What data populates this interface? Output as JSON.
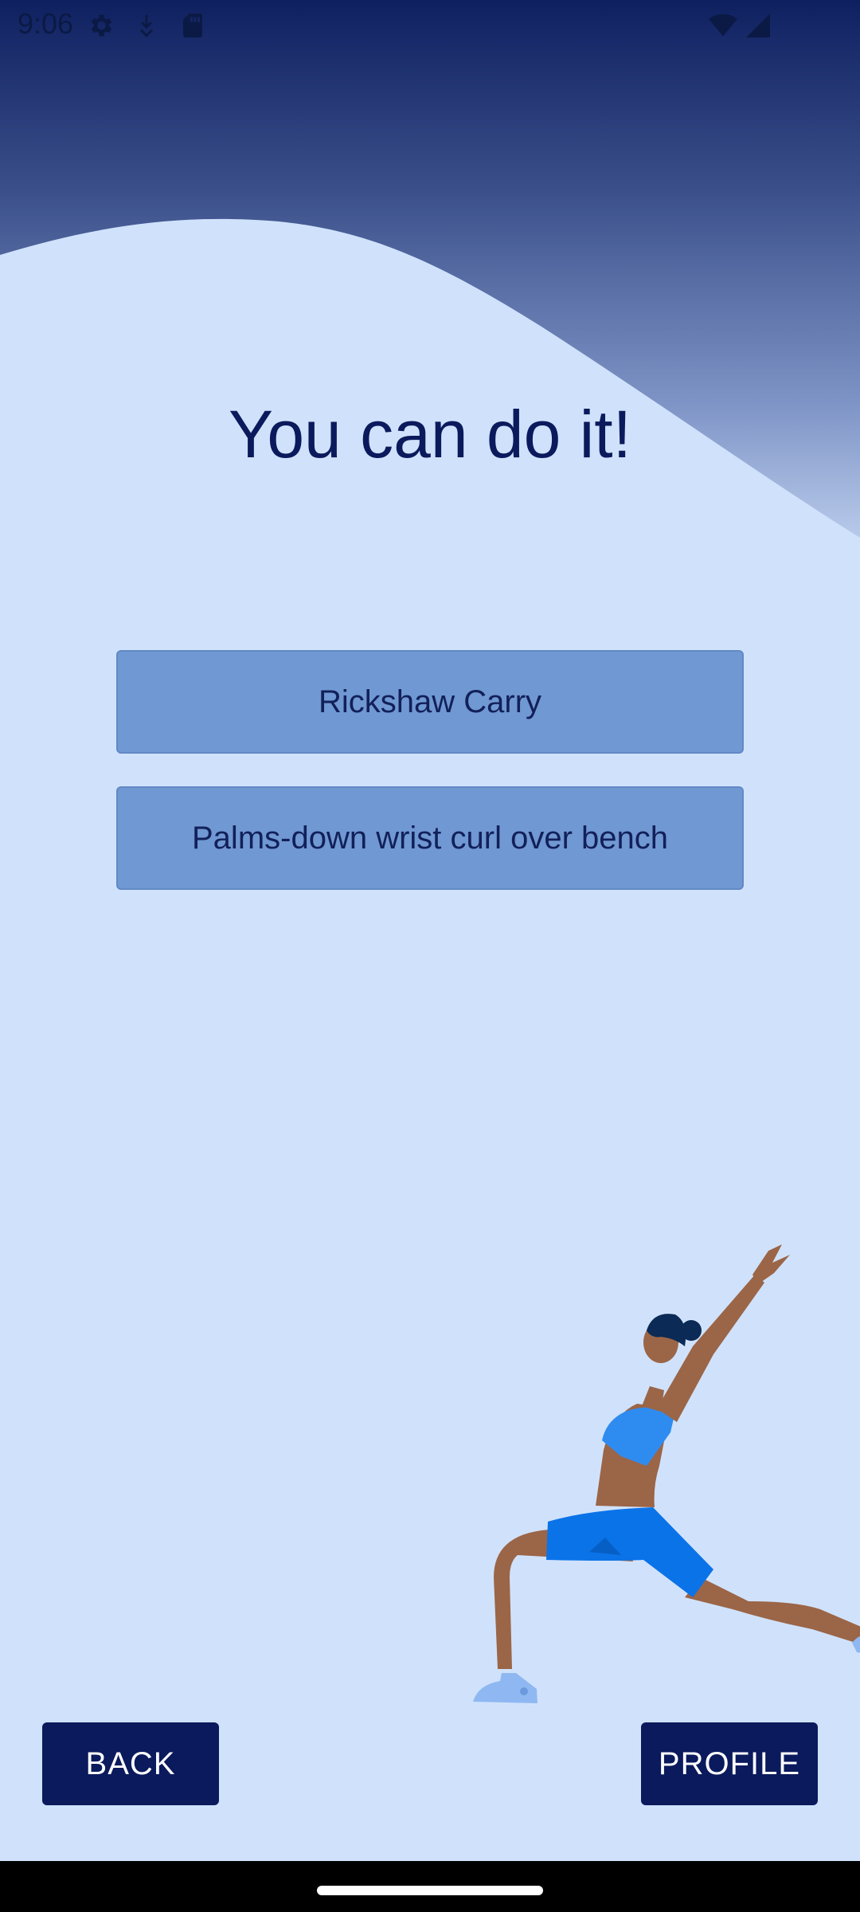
{
  "status_bar": {
    "time": "9:06",
    "icons": [
      "gear-icon",
      "download-icon",
      "sd-card-icon",
      "wifi-icon",
      "signal-icon"
    ]
  },
  "headline": "You can do it!",
  "exercises": [
    "Rickshaw Carry",
    "Palms-down wrist curl over bench"
  ],
  "buttons": {
    "back": "BACK",
    "profile": "PROFILE"
  },
  "colors": {
    "background": "#D0E2FB",
    "header_dark": "#0F2060",
    "header_light": "#A6B9DD",
    "exercise_button": "#7098D2",
    "nav_button": "#0B1A5C",
    "title_text": "#0B1A5C"
  },
  "illustration": "woman-lunge-stretch-illustration"
}
